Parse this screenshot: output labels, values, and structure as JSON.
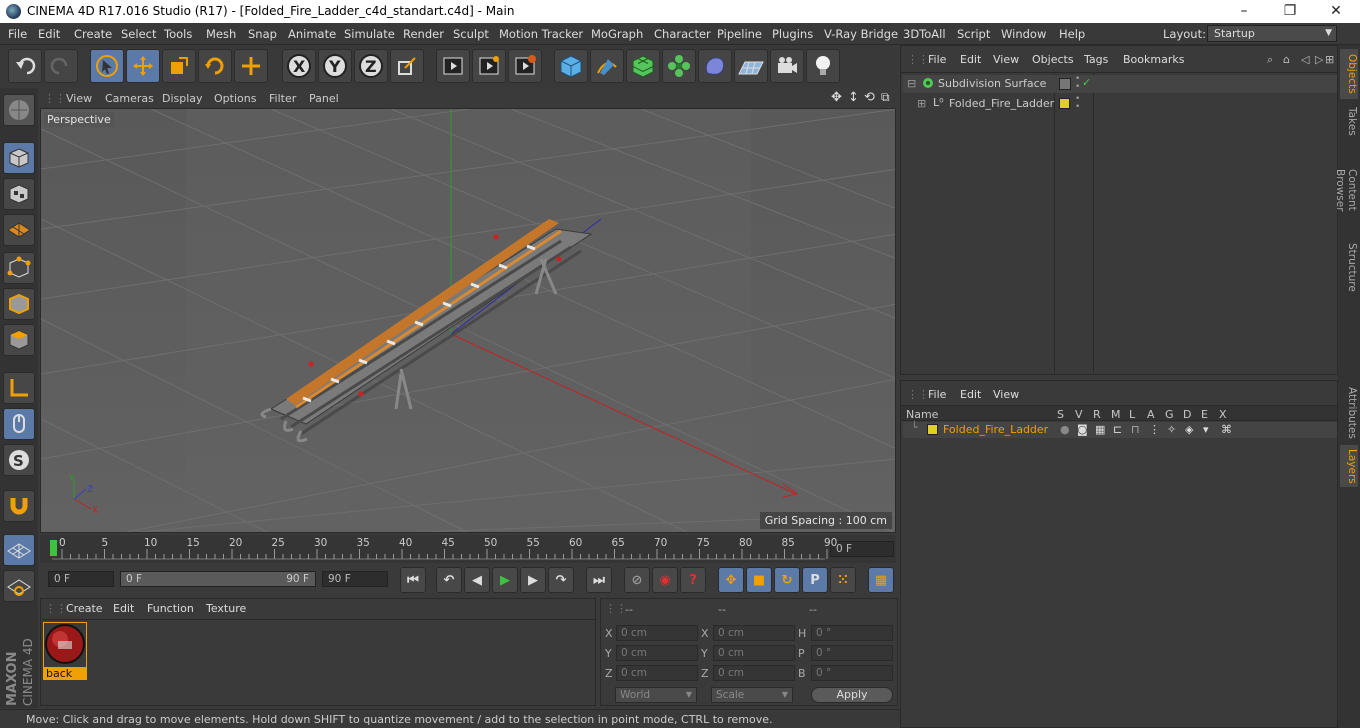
{
  "window": {
    "title": "CINEMA 4D R17.016 Studio (R17) - [Folded_Fire_Ladder_c4d_standart.c4d] - Main",
    "minimize": "–",
    "maximize": "❐",
    "close": "✕"
  },
  "menubar": {
    "items": [
      "File",
      "Edit",
      "Create",
      "Select",
      "Tools",
      "Mesh",
      "Snap",
      "Animate",
      "Simulate",
      "Render",
      "Sculpt",
      "Motion Tracker",
      "MoGraph",
      "Character",
      "Pipeline",
      "Plugins",
      "V-Ray Bridge",
      "3DToAll",
      "Script",
      "Window",
      "Help"
    ],
    "layout_label": "Layout:",
    "layout_value": "Startup"
  },
  "toolbar": {
    "icons": [
      "undo-icon",
      "redo-icon",
      "live-selection-icon",
      "move-icon",
      "scale-icon",
      "rotate-icon",
      "add-icon",
      "x-axis-icon",
      "y-axis-icon",
      "z-axis-icon",
      "world-coordinate-icon",
      "render-view-icon",
      "render-picture-viewer-icon",
      "edit-render-settings-icon",
      "cube-icon",
      "pen-icon",
      "subdivision-icon",
      "cloner-icon",
      "deformer-icon",
      "floor-icon",
      "camera-icon",
      "light-icon"
    ],
    "axis_x": "X",
    "axis_y": "Y",
    "axis_z": "Z"
  },
  "viewport": {
    "menu": [
      "View",
      "Cameras",
      "Display",
      "Options",
      "Filter",
      "Panel"
    ],
    "label": "Perspective",
    "grid_spacing": "Grid Spacing : 100 cm",
    "axis_x": "X",
    "axis_y": "Y",
    "axis_z": "Z"
  },
  "timeline": {
    "ticks": [
      "0",
      "5",
      "10",
      "15",
      "20",
      "25",
      "30",
      "35",
      "40",
      "45",
      "50",
      "55",
      "60",
      "65",
      "70",
      "75",
      "80",
      "85",
      "90"
    ],
    "current_frame": "0 F"
  },
  "anim": {
    "start": "0 F",
    "range_start": "0 F",
    "range_end": "90 F",
    "end": "90 F",
    "p_label": "P"
  },
  "materials": {
    "menu": [
      "Create",
      "Edit",
      "Function",
      "Texture"
    ],
    "material_name": "back"
  },
  "coords": {
    "headers": [
      "--",
      "--",
      "--"
    ],
    "rows": [
      {
        "a": "X",
        "av": "0 cm",
        "b": "X",
        "bv": "0 cm",
        "c": "H",
        "cv": "0 °"
      },
      {
        "a": "Y",
        "av": "0 cm",
        "b": "Y",
        "bv": "0 cm",
        "c": "P",
        "cv": "0 °"
      },
      {
        "a": "Z",
        "av": "0 cm",
        "b": "Z",
        "bv": "0 cm",
        "c": "B",
        "cv": "0 °"
      }
    ],
    "world": "World",
    "scale": "Scale",
    "apply": "Apply"
  },
  "objects": {
    "menu": [
      "File",
      "Edit",
      "View",
      "Objects",
      "Tags",
      "Bookmarks"
    ],
    "items": [
      {
        "name": "Subdivision Surface"
      },
      {
        "name": "Folded_Fire_Ladder"
      }
    ]
  },
  "layers": {
    "menu": [
      "File",
      "Edit",
      "View"
    ],
    "col_name": "Name",
    "cols": [
      "S",
      "V",
      "R",
      "M",
      "L",
      "A",
      "G",
      "D",
      "E",
      "X"
    ],
    "layer_name": "Folded_Fire_Ladder"
  },
  "righttabs": [
    "Objects",
    "Takes",
    "Content Browser",
    "Structure",
    "Attributes",
    "Layers"
  ],
  "status": "Move: Click and drag to move elements. Hold down SHIFT to quantize movement / add to the selection in point mode, CTRL to remove.",
  "brand": {
    "line1": "MAXON",
    "line2": "CINEMA 4D"
  },
  "colors": {
    "accent": "#f0a000",
    "selection": "#5b7aa8",
    "layer_color": "#e0d020"
  }
}
